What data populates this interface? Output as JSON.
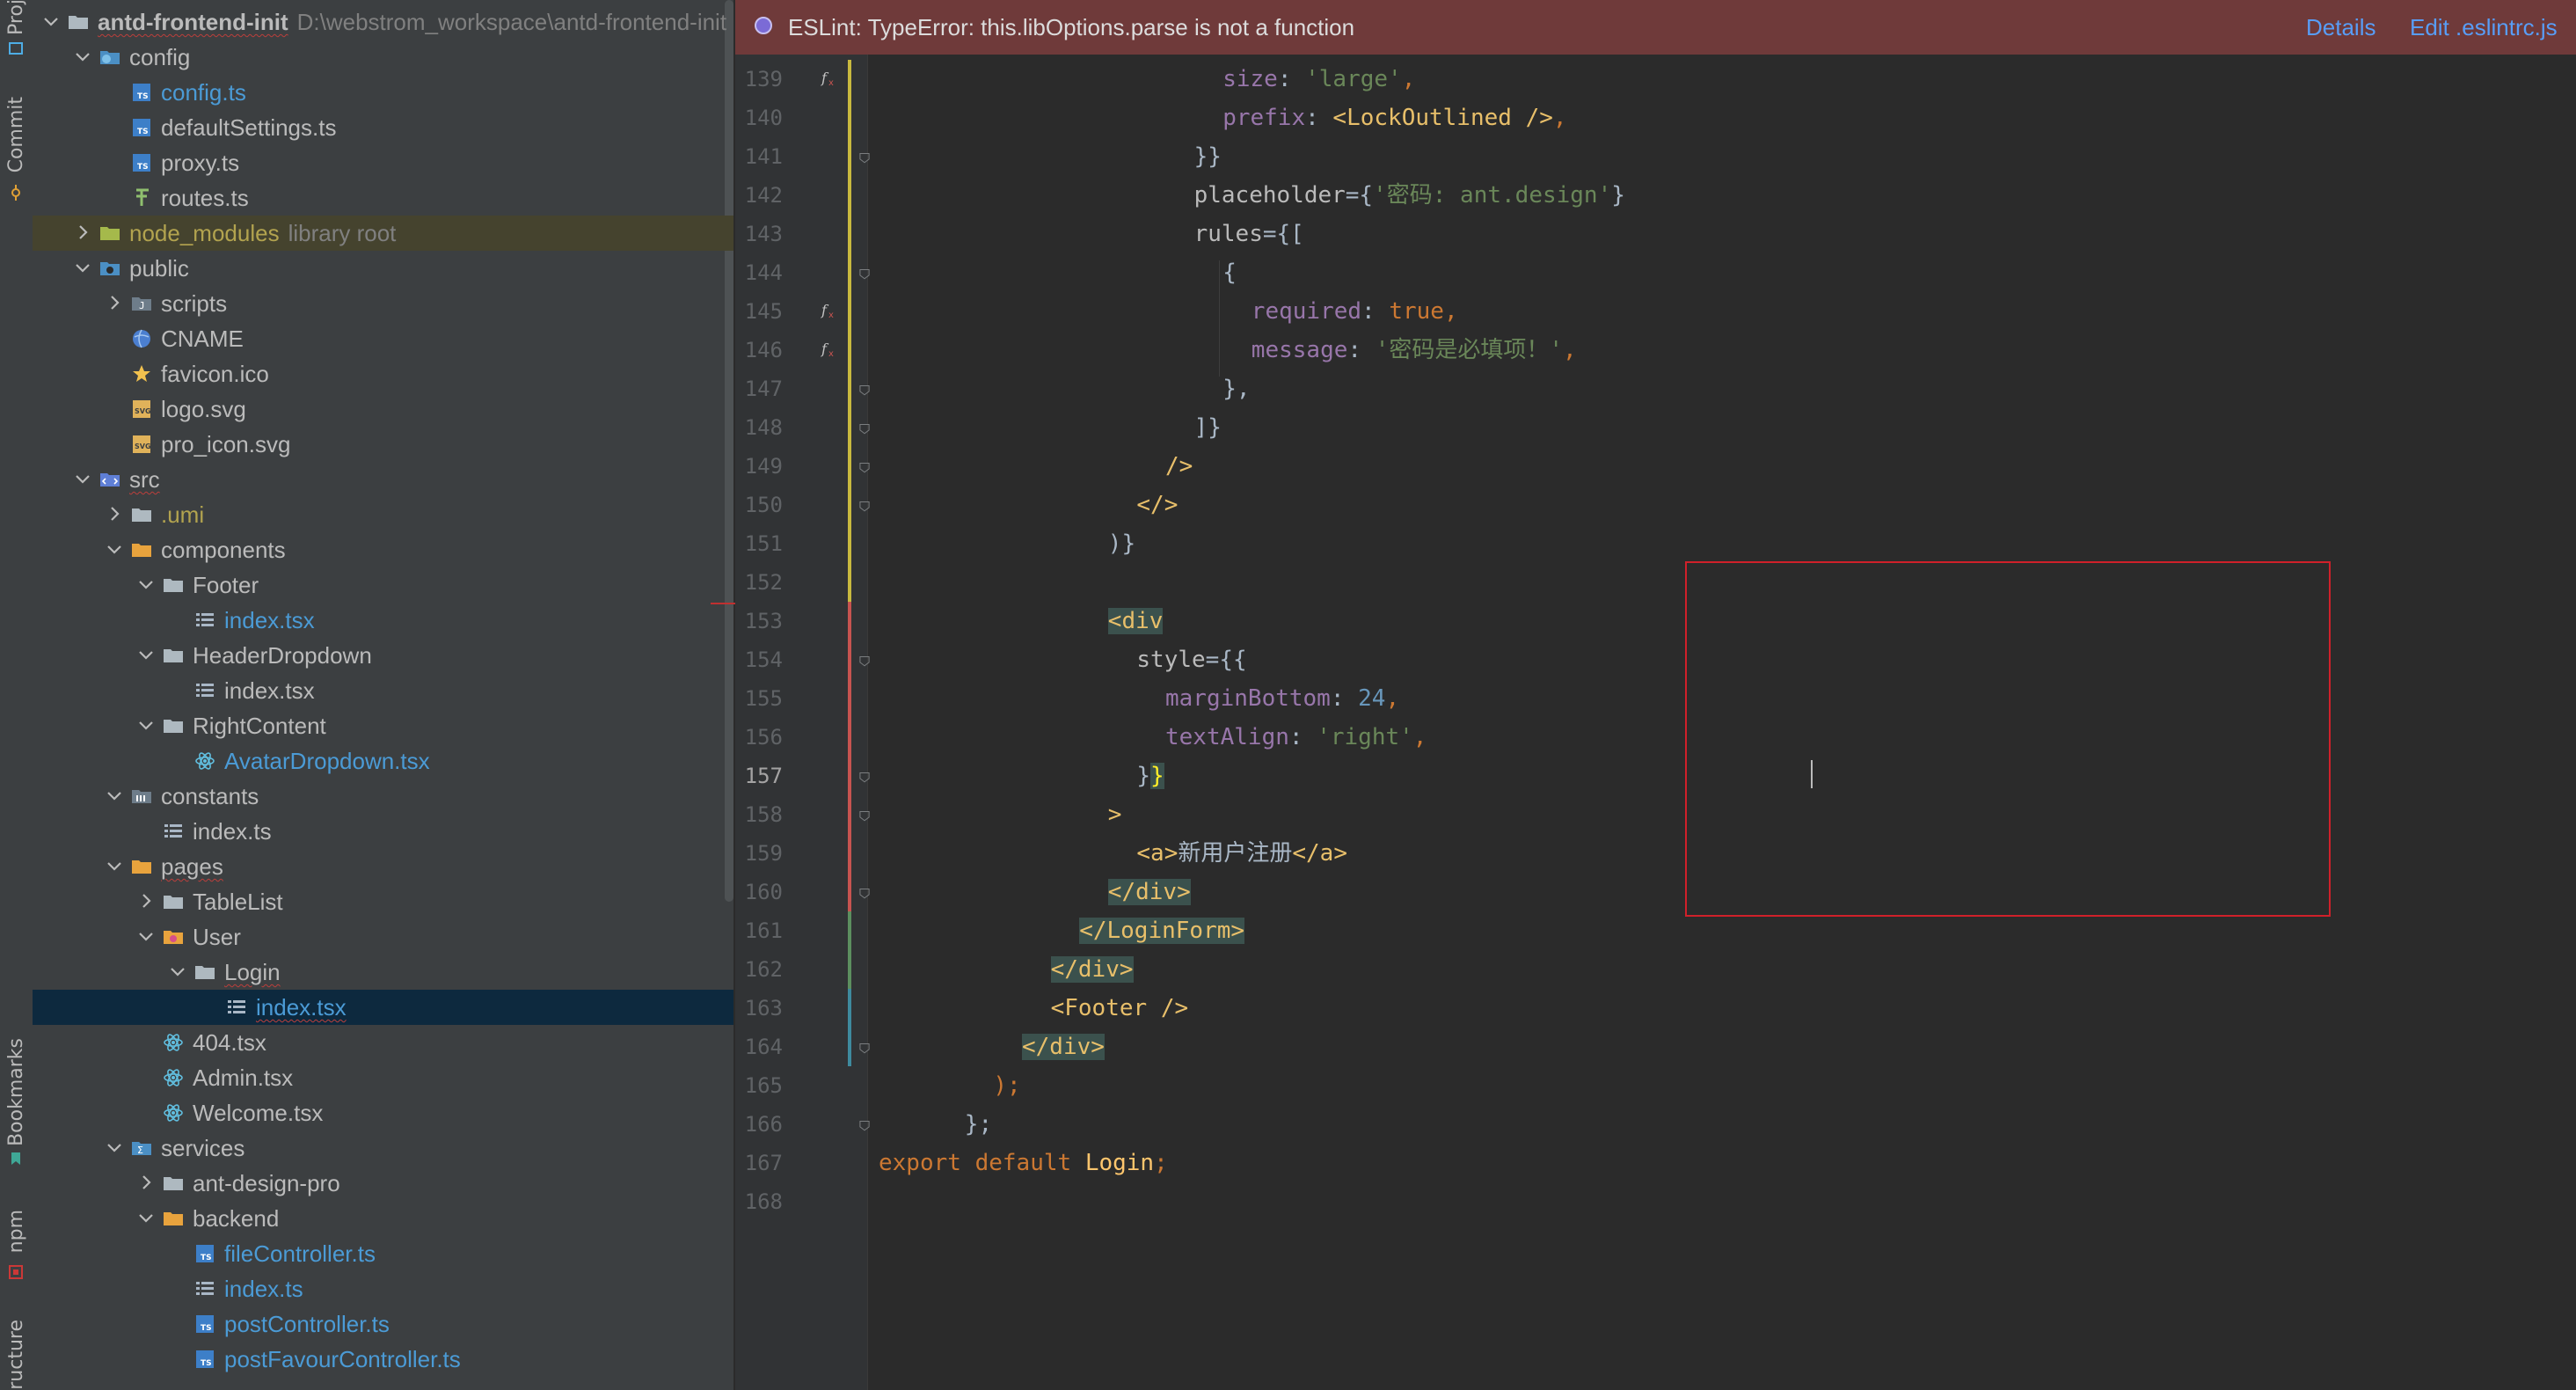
{
  "tool_strip": {
    "project_label": "Project",
    "commit_label": "Commit",
    "bookmarks_label": "Bookmarks",
    "npm_label": "npm",
    "structure_label": "Structure"
  },
  "project_tree": {
    "root": {
      "name": "antd-frontend-init",
      "path": "D:\\webstrom_workspace\\antd-frontend-init"
    },
    "items": [
      {
        "label": "config"
      },
      {
        "label": "config.ts"
      },
      {
        "label": "defaultSettings.ts"
      },
      {
        "label": "proxy.ts"
      },
      {
        "label": "routes.ts"
      },
      {
        "label": "node_modules",
        "extra": "library root"
      },
      {
        "label": "public"
      },
      {
        "label": "scripts"
      },
      {
        "label": "CNAME"
      },
      {
        "label": "favicon.ico"
      },
      {
        "label": "logo.svg"
      },
      {
        "label": "pro_icon.svg"
      },
      {
        "label": "src"
      },
      {
        "label": ".umi"
      },
      {
        "label": "components"
      },
      {
        "label": "Footer"
      },
      {
        "label": "index.tsx"
      },
      {
        "label": "HeaderDropdown"
      },
      {
        "label": "index.tsx"
      },
      {
        "label": "RightContent"
      },
      {
        "label": "AvatarDropdown.tsx"
      },
      {
        "label": "constants"
      },
      {
        "label": "index.ts"
      },
      {
        "label": "pages"
      },
      {
        "label": "TableList"
      },
      {
        "label": "User"
      },
      {
        "label": "Login"
      },
      {
        "label": "index.tsx"
      },
      {
        "label": "404.tsx"
      },
      {
        "label": "Admin.tsx"
      },
      {
        "label": "Welcome.tsx"
      },
      {
        "label": "services"
      },
      {
        "label": "ant-design-pro"
      },
      {
        "label": "backend"
      },
      {
        "label": "fileController.ts"
      },
      {
        "label": "index.ts"
      },
      {
        "label": "postController.ts"
      },
      {
        "label": "postFavourController.ts"
      }
    ]
  },
  "notification": {
    "message": "ESLint: TypeError: this.libOptions.parse is not a function",
    "details_link": "Details",
    "edit_link": "Edit .eslintrc.js"
  },
  "editor": {
    "current_line": 157,
    "line_numbers": [
      "139",
      "140",
      "141",
      "142",
      "143",
      "144",
      "145",
      "146",
      "147",
      "148",
      "149",
      "150",
      "151",
      "152",
      "153",
      "154",
      "155",
      "156",
      "157",
      "158",
      "159",
      "160",
      "161",
      "162",
      "163",
      "164",
      "165",
      "166",
      "167",
      "168"
    ]
  },
  "code": {
    "l139_key": "size",
    "l139_val": "'large'",
    "l140_key": "prefix",
    "l140_tag": "<LockOutlined />",
    "l141": "}}",
    "l142_attr": "placeholder",
    "l142_val": "'密码: ant.design'",
    "l143_attr": "rules",
    "l143_rest": "={[",
    "l144": "{",
    "l145_key": "required",
    "l145_val": "true",
    "l146_key": "message",
    "l146_val": "'密码是必填项！'",
    "l147": "},",
    "l148": "]}",
    "l149": "/>",
    "l150": "</>",
    "l151": ")}",
    "l152": "",
    "l153": "<div",
    "l154_attr": "style",
    "l154_rest": "={{",
    "l155_key": "marginBottom",
    "l155_val": "24",
    "l156_key": "textAlign",
    "l156_val": "'right'",
    "l157_a": "}",
    "l157_b": "}",
    "l158": ">",
    "l159_open": "<a>",
    "l159_text": "新用户注册",
    "l159_close": "</a>",
    "l160": "</div>",
    "l161": "</LoginForm>",
    "l162": "</div>",
    "l163": "<Footer />",
    "l164": "</div>",
    "l165": ");",
    "l166": "};",
    "l167_kw1": "export",
    "l167_kw2": "default",
    "l167_name": "Login",
    "l168": ""
  },
  "colors": {
    "error_box": "#d0202a",
    "notification_bg": "#6f3a3a",
    "link": "#589df6"
  }
}
